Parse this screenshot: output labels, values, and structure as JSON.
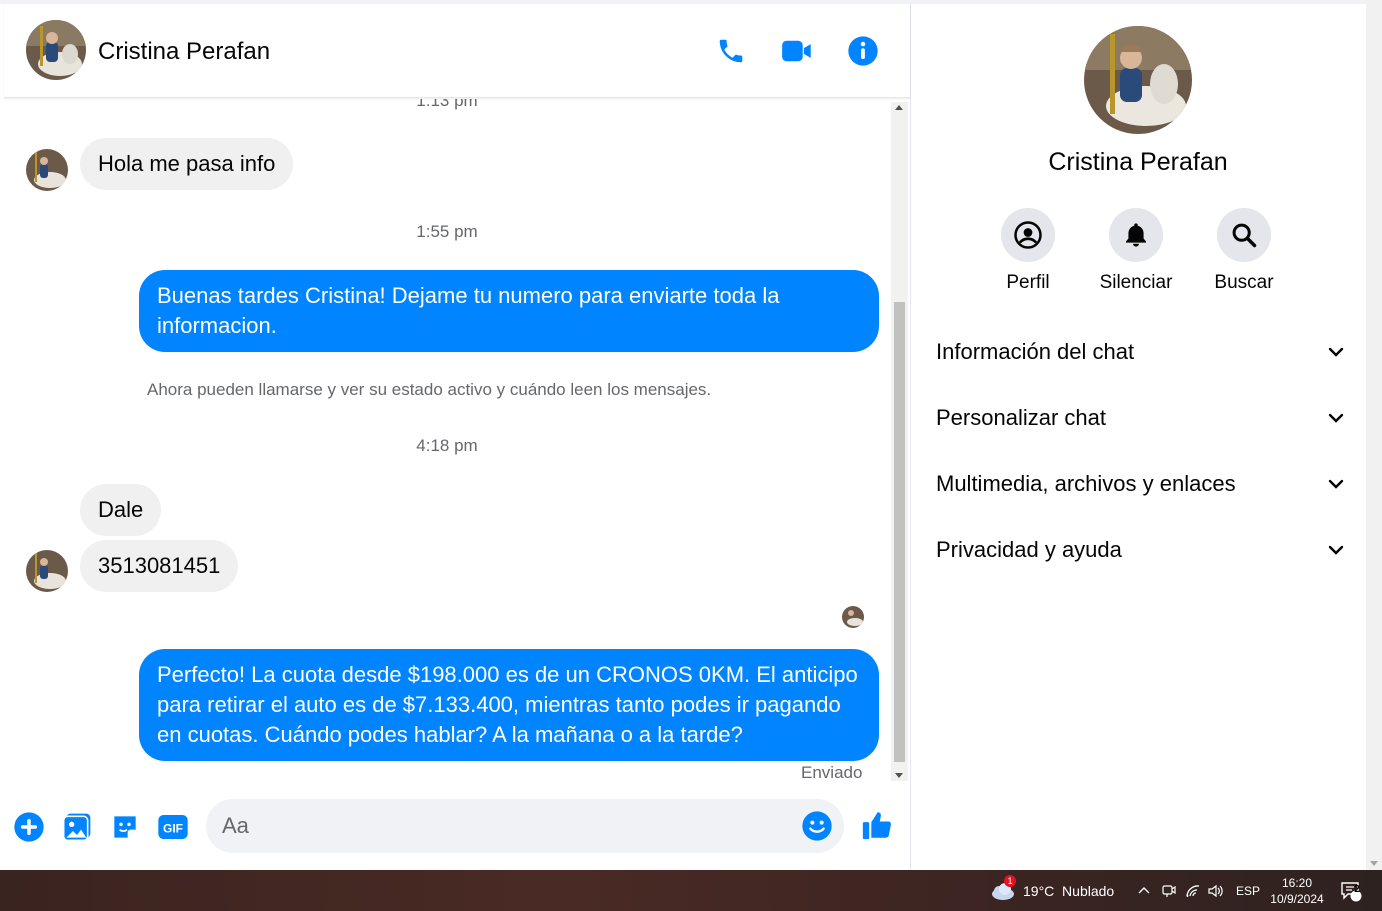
{
  "chat": {
    "contact_name": "Cristina Perafan",
    "partial_timestamp": "1:13 pm",
    "messages": [
      {
        "type": "incoming",
        "text": "Hola me pasa info"
      },
      {
        "type": "timestamp",
        "text": "1:55 pm"
      },
      {
        "type": "outgoing",
        "text": "Buenas tardes Cristina! Dejame tu numero para enviarte toda la informacion."
      },
      {
        "type": "system",
        "text": "Ahora pueden llamarse y ver su estado activo y cuándo leen los mensajes."
      },
      {
        "type": "timestamp",
        "text": "4:18 pm"
      },
      {
        "type": "incoming",
        "text": "Dale"
      },
      {
        "type": "incoming",
        "text": "3513081451"
      },
      {
        "type": "outgoing",
        "text": "Perfecto! La cuota desde $198.000 es de un CRONOS 0KM. El anticipo para retirar el auto es de $7.133.400, mientras tanto podes ir pagando en cuotas. Cuándo podes hablar? A la mañana o a la tarde?"
      }
    ],
    "status": "Enviado",
    "header_icons": [
      "phone-icon",
      "video-camera-icon",
      "info-icon"
    ]
  },
  "composer": {
    "placeholder": "Aa",
    "icons": [
      "plus-icon",
      "image-icon",
      "sticker-icon",
      "gif-icon",
      "emoji-icon",
      "thumbs-up-icon"
    ],
    "gif_label": "GIF"
  },
  "info_panel": {
    "name": "Cristina Perafan",
    "actions": [
      {
        "label": "Perfil",
        "icon": "profile-icon"
      },
      {
        "label": "Silenciar",
        "icon": "bell-icon"
      },
      {
        "label": "Buscar",
        "icon": "search-icon"
      }
    ],
    "sections": [
      {
        "label": "Información del chat"
      },
      {
        "label": "Personalizar chat"
      },
      {
        "label": "Multimedia, archivos y enlaces"
      },
      {
        "label": "Privacidad y ayuda"
      }
    ]
  },
  "taskbar": {
    "weather": "19°C  Nublado",
    "weather_badge": "1",
    "language": "ESP",
    "time": "16:20",
    "date": "10/9/2024",
    "notification_count": "2"
  },
  "colors": {
    "accent": "#0084ff",
    "incoming_bubble": "#f0f0f0",
    "secondary_text": "#65676b"
  }
}
